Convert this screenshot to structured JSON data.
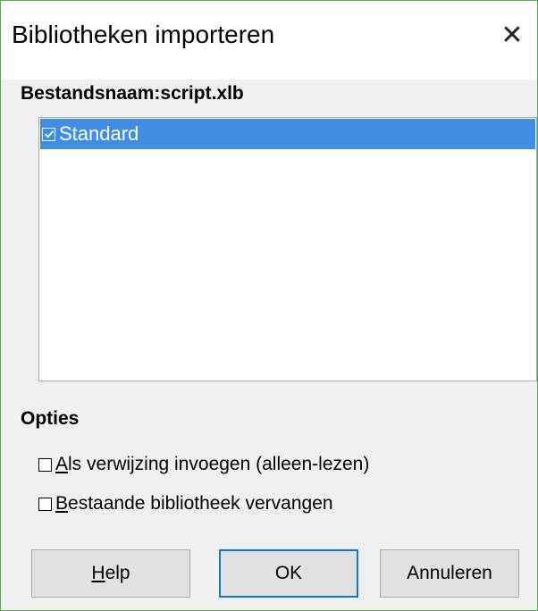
{
  "dialog": {
    "title": "Bibliotheken importeren",
    "close_glyph": "✕"
  },
  "file": {
    "label": "Bestandsnaam:",
    "name": "script.xlb"
  },
  "libraries": [
    {
      "label": "Standard",
      "checked": true,
      "selected": true
    }
  ],
  "options": {
    "heading": "Opties",
    "items": [
      {
        "mnemonic": "A",
        "rest": "ls verwijzing invoegen (alleen-lezen)",
        "checked": false
      },
      {
        "mnemonic": "B",
        "rest": "estaande bibliotheek vervangen",
        "checked": false
      }
    ]
  },
  "buttons": {
    "help_mnemonic": "H",
    "help_rest": "elp",
    "ok": "OK",
    "cancel": "Annuleren"
  },
  "colors": {
    "selection": "#3f8ee4",
    "window_border": "#4fae4f",
    "default_button_border": "#0a78d7"
  },
  "icons": {
    "close": "close-icon",
    "checkbox_checked": "checkbox-checked-icon",
    "checkbox_unchecked": "checkbox-unchecked-icon"
  }
}
